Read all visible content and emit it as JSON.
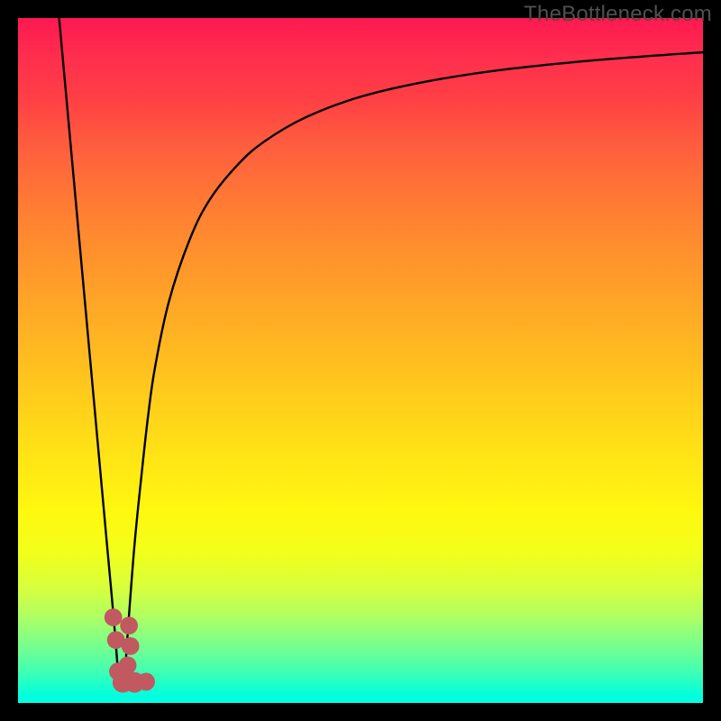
{
  "watermark": "TheBottleneck.com",
  "chart_data": {
    "type": "line",
    "title": "",
    "xlabel": "",
    "ylabel": "",
    "xlim": [
      0,
      100
    ],
    "ylim": [
      0,
      100
    ],
    "grid": false,
    "legend": false,
    "series": [
      {
        "name": "left-branch",
        "x": [
          6.0,
          7.0,
          8.0,
          9.0,
          10.0,
          11.0,
          12.0,
          13.0,
          14.0,
          14.8
        ],
        "y": [
          100.0,
          89.0,
          78.0,
          67.0,
          56.0,
          45.0,
          34.0,
          23.0,
          12.0,
          2.0
        ]
      },
      {
        "name": "right-branch",
        "x": [
          15.5,
          16.0,
          17.0,
          18.0,
          19.0,
          20.0,
          22.0,
          25.0,
          28.0,
          32.0,
          36.0,
          42.0,
          50.0,
          60.0,
          72.0,
          85.0,
          100.0
        ],
        "y": [
          2.0,
          10.0,
          23.0,
          33.0,
          42.0,
          49.0,
          58.5,
          67.5,
          73.5,
          78.5,
          82.0,
          85.5,
          88.5,
          90.8,
          92.6,
          93.9,
          95.0
        ]
      }
    ],
    "markers": [
      {
        "name": "marker-a",
        "x": 13.9,
        "y": 12.5,
        "r": 1.3
      },
      {
        "name": "marker-b",
        "x": 14.3,
        "y": 9.2,
        "r": 1.3
      },
      {
        "name": "marker-c",
        "x": 16.2,
        "y": 11.3,
        "r": 1.3
      },
      {
        "name": "marker-d",
        "x": 16.4,
        "y": 8.3,
        "r": 1.3
      },
      {
        "name": "marker-e",
        "x": 16.0,
        "y": 5.5,
        "r": 1.3
      },
      {
        "name": "marker-f",
        "x": 15.3,
        "y": 3.0,
        "r": 1.5
      },
      {
        "name": "marker-g",
        "x": 14.6,
        "y": 4.6,
        "r": 1.3
      },
      {
        "name": "marker-h",
        "x": 17.0,
        "y": 3.0,
        "r": 1.5
      },
      {
        "name": "marker-i",
        "x": 18.7,
        "y": 3.1,
        "r": 1.3
      }
    ],
    "marker_color": "#c15960",
    "curve_color": "#000000"
  }
}
